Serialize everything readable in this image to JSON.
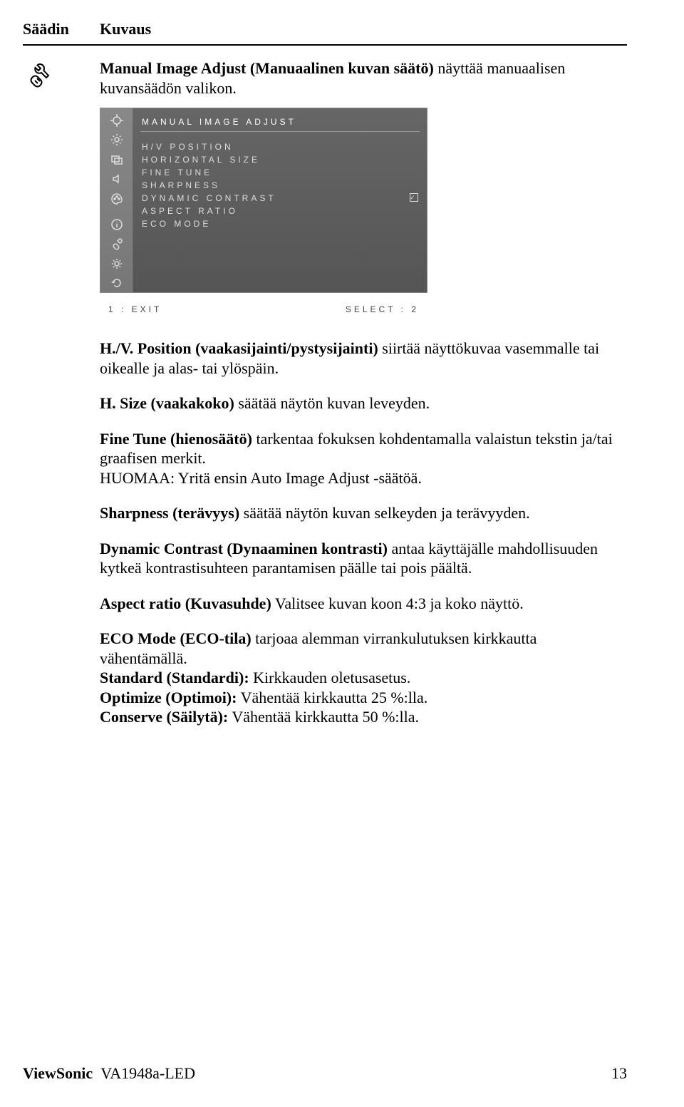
{
  "header": {
    "col1": "Säädin",
    "col2": "Kuvaus"
  },
  "intro": {
    "bold": "Manual Image Adjust (Manuaalinen kuvan säätö)",
    "rest": " näyttää manuaalisen kuvansäädön valikon."
  },
  "osd": {
    "title": "MANUAL IMAGE ADJUST",
    "items": [
      {
        "label": "H/V POSITION",
        "check": false
      },
      {
        "label": "HORIZONTAL SIZE",
        "check": false
      },
      {
        "label": "FINE TUNE",
        "check": false
      },
      {
        "label": "SHARPNESS",
        "check": false
      },
      {
        "label": "DYNAMIC CONTRAST",
        "check": true
      },
      {
        "label": "ASPECT RATIO",
        "check": false
      },
      {
        "label": "ECO MODE",
        "check": false
      }
    ],
    "footer_left": "1 : EXIT",
    "footer_right": "SELECT : 2"
  },
  "p_hv": {
    "bold": "H./V. Position (vaakasijainti/pystysijainti)",
    "rest": " siirtää näyttökuvaa vasemmalle tai oikealle ja alas- tai ylöspäin."
  },
  "p_hsize": {
    "bold": "H. Size (vaakakoko)",
    "rest": " säätää näytön kuvan leveyden."
  },
  "p_fine": {
    "bold": "Fine Tune (hienosäätö)",
    "rest": " tarkentaa fokuksen kohdentamalla valaistun tekstin ja/tai graafisen merkit.",
    "note": "HUOMAA: Yritä ensin Auto Image Adjust -säätöä."
  },
  "p_sharp": {
    "bold": "Sharpness (terävyys)",
    "rest": " säätää näytön kuvan selkeyden ja terävyyden."
  },
  "p_dyn": {
    "bold": "Dynamic Contrast (Dynaaminen kontrasti)",
    "rest": " antaa käyttäjälle mahdollisuuden kytkeä kontrastisuhteen parantamisen päälle tai pois päältä."
  },
  "p_aspect": {
    "bold": "Aspect ratio (Kuvasuhde)",
    "rest": " Valitsee kuvan koon 4:3 ja koko näyttö."
  },
  "p_eco": {
    "bold": "ECO Mode (ECO-tila)",
    "rest": " tarjoaa alemman virrankulutuksen kirkkautta vähentämällä.",
    "l1b": "Standard (Standardi):",
    "l1r": " Kirkkauden oletusasetus.",
    "l2b": "Optimize (Optimoi):",
    "l2r": " Vähentää kirkkautta 25 %:lla.",
    "l3b": "Conserve (Säilytä):",
    "l3r": " Vähentää kirkkautta 50 %:lla."
  },
  "footer": {
    "brand": "ViewSonic",
    "model": "VA1948a-LED",
    "page": "13"
  }
}
